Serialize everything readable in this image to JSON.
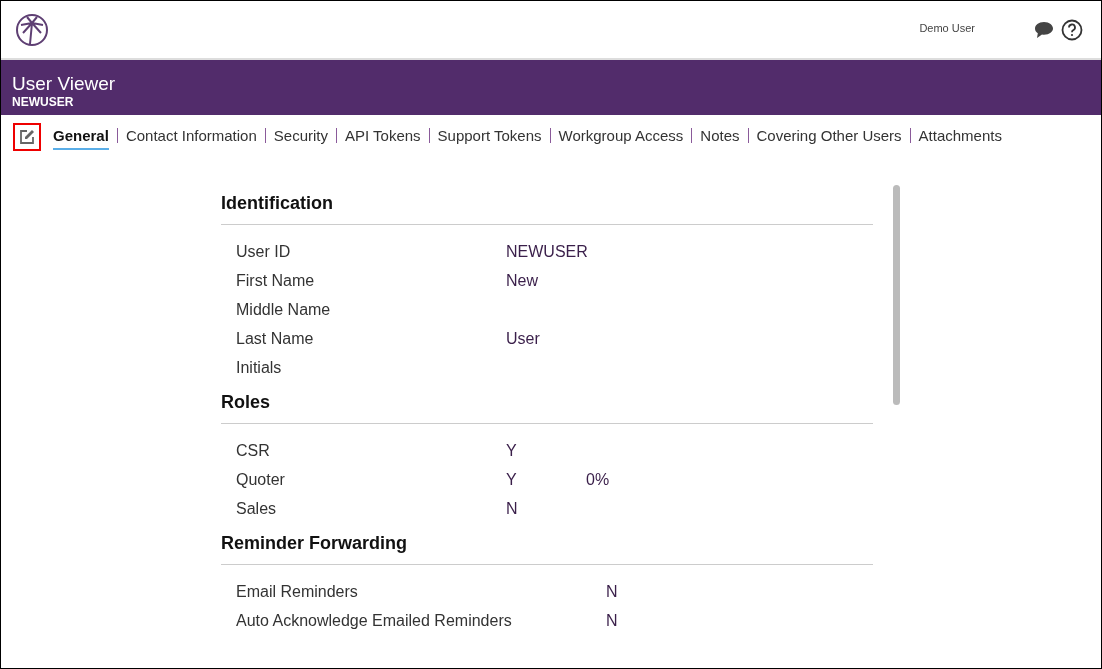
{
  "topbar": {
    "user": "Demo User"
  },
  "header": {
    "title": "User Viewer",
    "subtitle": "NEWUSER"
  },
  "tabs": [
    {
      "label": "General",
      "selected": true
    },
    {
      "label": "Contact Information",
      "selected": false
    },
    {
      "label": "Security",
      "selected": false
    },
    {
      "label": "API Tokens",
      "selected": false
    },
    {
      "label": "Support Tokens",
      "selected": false
    },
    {
      "label": "Workgroup Access",
      "selected": false
    },
    {
      "label": "Notes",
      "selected": false
    },
    {
      "label": "Covering Other Users",
      "selected": false
    },
    {
      "label": "Attachments",
      "selected": false
    }
  ],
  "sections": [
    {
      "title": "Identification",
      "kind": "standard",
      "rows": [
        {
          "label": "User ID",
          "value": "NEWUSER"
        },
        {
          "label": "First Name",
          "value": "New"
        },
        {
          "label": "Middle Name"
        },
        {
          "label": "Last Name",
          "value": "User"
        },
        {
          "label": "Initials"
        }
      ]
    },
    {
      "title": "Roles",
      "kind": "standard",
      "rows": [
        {
          "label": "CSR",
          "value": "Y"
        },
        {
          "label": "Quoter",
          "value": "Y",
          "extra": "0%"
        },
        {
          "label": "Sales",
          "value": "N"
        }
      ]
    },
    {
      "title": "Reminder Forwarding",
      "kind": "wide",
      "rows": [
        {
          "label": "Email Reminders",
          "value": "N"
        },
        {
          "label": "Auto Acknowledge Emailed Reminders",
          "value": "N"
        }
      ]
    }
  ]
}
